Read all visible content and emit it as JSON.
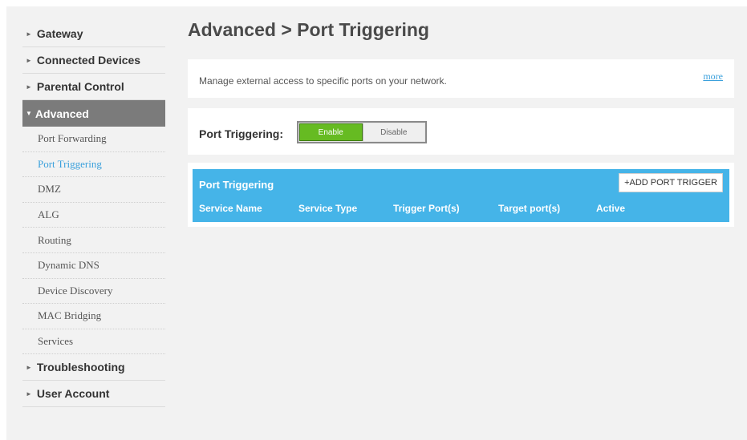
{
  "sidebar": {
    "main_top": [
      {
        "label": "Gateway"
      },
      {
        "label": "Connected Devices"
      },
      {
        "label": "Parental Control"
      }
    ],
    "active_label": "Advanced",
    "sub_items": [
      {
        "label": "Port Forwarding"
      },
      {
        "label": "Port Triggering"
      },
      {
        "label": "DMZ"
      },
      {
        "label": "ALG"
      },
      {
        "label": "Routing"
      },
      {
        "label": "Dynamic DNS"
      },
      {
        "label": "Device Discovery"
      },
      {
        "label": "MAC Bridging"
      },
      {
        "label": "Services"
      }
    ],
    "main_bottom": [
      {
        "label": "Troubleshooting"
      },
      {
        "label": "User Account"
      }
    ]
  },
  "page": {
    "title": "Advanced > Port Triggering",
    "description": "Manage external access to specific ports on your network.",
    "more_link": "more"
  },
  "toggle": {
    "label": "Port Triggering:",
    "enable": "Enable",
    "disable": "Disable",
    "selected": "Enable"
  },
  "table": {
    "title": "Port Triggering",
    "add_button": "+ADD PORT TRIGGER",
    "columns": [
      "Service Name",
      "Service Type",
      "Trigger Port(s)",
      "Target port(s)",
      "Active"
    ],
    "rows": []
  },
  "colors": {
    "accent": "#45b4e8",
    "enable_green": "#66bb22",
    "active_nav": "#7b7b7b",
    "link": "#3aa0dc"
  }
}
